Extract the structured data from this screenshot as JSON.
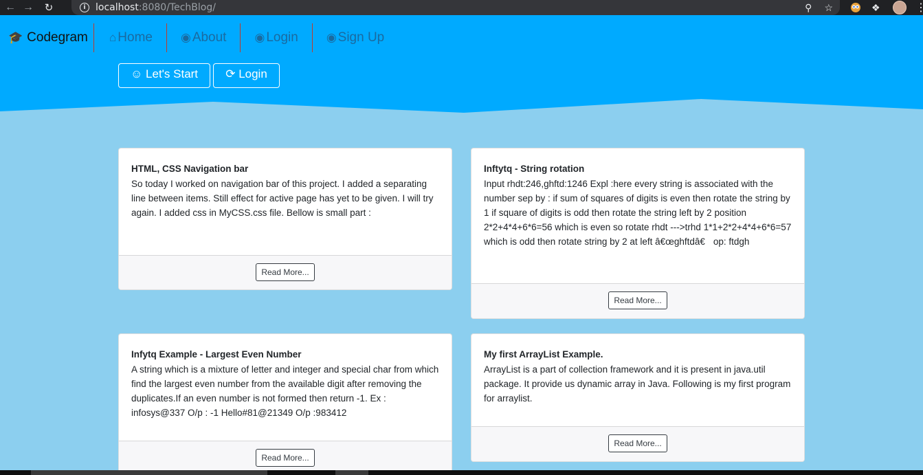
{
  "browser": {
    "back_icon": "arrow-left-icon",
    "forward_icon": "arrow-right-icon",
    "reload_icon": "reload-icon",
    "url_host": "localhost",
    "url_rest": ":8080/TechBlog/"
  },
  "navbar": {
    "brand": "Codegram",
    "items": [
      {
        "label": "Home",
        "icon": "home-icon"
      },
      {
        "label": "About",
        "icon": "user-circle-icon"
      },
      {
        "label": "Login",
        "icon": "user-circle-icon"
      },
      {
        "label": "Sign Up",
        "icon": "user-circle-icon"
      }
    ]
  },
  "hero": {
    "start_label": "Let's Start",
    "login_label": "Login"
  },
  "posts": [
    {
      "title": "HTML, CSS Navigation bar",
      "text": "So today I worked on navigation bar of this project. I added a separating line between items. Still effect for active page has yet to be given. I will try again. I added css in MyCSS.css file. Bellow is small part :",
      "button": "Read More..."
    },
    {
      "title": "Inftytq - String rotation",
      "text": "Input rhdt:246,ghftd:1246 Expl :here every string is associated with the number sep by : if sum of squares of digits is even then rotate the string by 1 if square of digits is odd then rotate the string left by 2 position 2*2+4*4+6*6=56 which is even so rotate rhdt --->trhd 1*1+2*2+4*4+6*6=57 which is odd then rotate string by 2 at left â€œghftdâ€ op: ftdgh",
      "button": "Read More..."
    },
    {
      "title": "Infytq Example - Largest Even Number",
      "text": "A string which is a mixture of letter and integer and special char from which find the largest even number from the available digit after removing the duplicates.If an even number is not formed then return -1. Ex : infosys@337 O/p : -1 Hello#81@21349 O/p :983412",
      "button": "Read More..."
    },
    {
      "title": "My first ArrayList Example.",
      "text": "ArrayList is a part of collection framework and it is present in java.util package. It provide us dynamic array in Java. Following is my first program for arraylist.",
      "button": "Read More..."
    }
  ],
  "colors": {
    "hero_blue": "#00aaff",
    "page_bg": "#8ccfef",
    "nav_divider": "#c0392b",
    "nav_link": "#1a6aa0"
  }
}
